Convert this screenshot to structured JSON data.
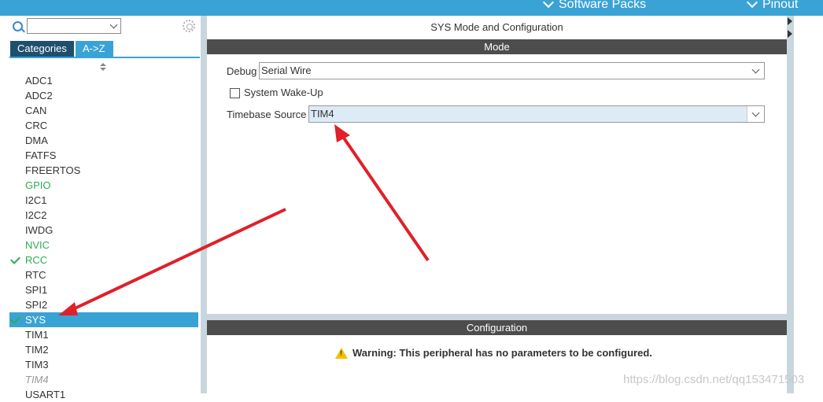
{
  "topbar": {
    "items": [
      "Software Packs",
      "Pinout"
    ]
  },
  "sidebar": {
    "tabs": [
      "Categories",
      "A->Z"
    ],
    "items": [
      {
        "label": "ADC1",
        "state": "normal"
      },
      {
        "label": "ADC2",
        "state": "normal"
      },
      {
        "label": "CAN",
        "state": "normal"
      },
      {
        "label": "CRC",
        "state": "normal"
      },
      {
        "label": "DMA",
        "state": "normal"
      },
      {
        "label": "FATFS",
        "state": "normal"
      },
      {
        "label": "FREERTOS",
        "state": "normal"
      },
      {
        "label": "GPIO",
        "state": "green"
      },
      {
        "label": "I2C1",
        "state": "normal"
      },
      {
        "label": "I2C2",
        "state": "normal"
      },
      {
        "label": "IWDG",
        "state": "normal"
      },
      {
        "label": "NVIC",
        "state": "green"
      },
      {
        "label": "RCC",
        "state": "green-check"
      },
      {
        "label": "RTC",
        "state": "normal"
      },
      {
        "label": "SPI1",
        "state": "normal"
      },
      {
        "label": "SPI2",
        "state": "normal"
      },
      {
        "label": "SYS",
        "state": "selected-check"
      },
      {
        "label": "TIM1",
        "state": "normal"
      },
      {
        "label": "TIM2",
        "state": "normal"
      },
      {
        "label": "TIM3",
        "state": "normal"
      },
      {
        "label": "TIM4",
        "state": "italic"
      },
      {
        "label": "USART1",
        "state": "normal"
      }
    ]
  },
  "main": {
    "title": "SYS Mode and Configuration",
    "mode_label": "Mode",
    "debug_label": "Debug",
    "debug_value": "Serial Wire",
    "wakeup_label": "System Wake-Up",
    "timebase_label": "Timebase Source",
    "timebase_value": "TIM4",
    "config_label": "Configuration",
    "warning_bold": "Warning: This peripheral has no parameters to be configured."
  },
  "watermark": "https://blog.csdn.net/qq153471503",
  "colors": {
    "accent": "#3aa3d6",
    "tab_dark": "#1f4f6e",
    "section_bar": "#4d4d4d",
    "green": "#2eaa55",
    "arrow": "#e0202a",
    "warning": "#f2c200"
  }
}
